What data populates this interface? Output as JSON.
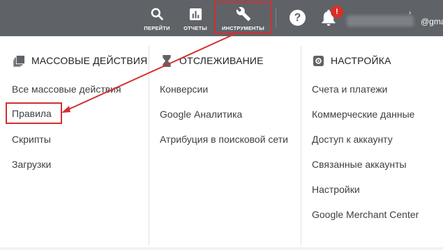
{
  "topbar": {
    "nav": {
      "go": "ПЕРЕЙТИ",
      "reports": "ОТЧЕТЫ",
      "tools": "ИНСТРУМЕНТЫ"
    },
    "help_glyph": "?",
    "notification_badge": "!",
    "account_email": "@gma",
    "icons": [
      "search-icon",
      "bar-chart-icon",
      "wrench-icon",
      "help-icon",
      "bell-icon"
    ],
    "bg_color": "#5f6368"
  },
  "menu": {
    "columns": [
      {
        "icon": "bulk-actions-icon",
        "heading": "МАССОВЫЕ ДЕЙСТВИЯ",
        "items": [
          "Все массовые действия",
          "Правила",
          "Скрипты",
          "Загрузки"
        ]
      },
      {
        "icon": "hourglass-icon",
        "heading": "ОТСЛЕЖИВАНИЕ",
        "items": [
          "Конверсии",
          "Google Аналитика",
          "Атрибуция в поисковой сети"
        ]
      },
      {
        "icon": "settings-icon",
        "heading": "НАСТРОЙКА",
        "items": [
          "Счета и платежи",
          "Коммерческие данные",
          "Доступ к аккаунту",
          "Связанные аккаунты",
          "Настройки",
          "Google Merchant Center"
        ]
      }
    ]
  },
  "annotation": {
    "color": "#d32f2f"
  }
}
